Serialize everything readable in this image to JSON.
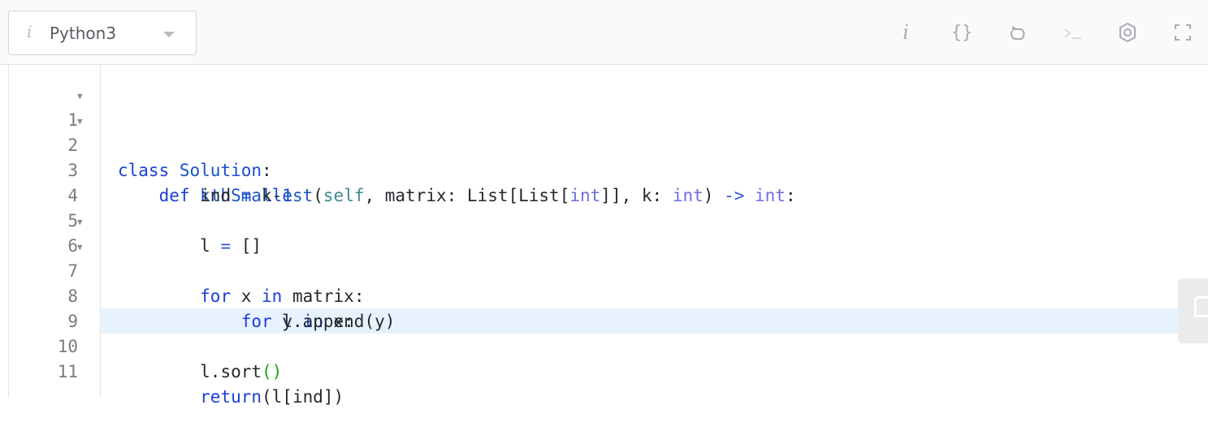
{
  "toolbar": {
    "language": {
      "info_glyph": "i",
      "label": "Python3",
      "caret": "dropdown-caret"
    },
    "icons": {
      "info": "i",
      "braces": "{}",
      "reset": "reset-icon",
      "console": "console-icon",
      "settings": "settings-icon",
      "fullscreen": "fullscreen-icon"
    }
  },
  "editor": {
    "active_line": 10,
    "lines": [
      {
        "n": "1",
        "fold": true
      },
      {
        "n": "2",
        "fold": true
      },
      {
        "n": "3",
        "fold": false
      },
      {
        "n": "4",
        "fold": false
      },
      {
        "n": "5",
        "fold": false
      },
      {
        "n": "6",
        "fold": true
      },
      {
        "n": "7",
        "fold": true
      },
      {
        "n": "8",
        "fold": false
      },
      {
        "n": "9",
        "fold": false
      },
      {
        "n": "10",
        "fold": false
      },
      {
        "n": "11",
        "fold": false
      }
    ],
    "code": {
      "l1": {
        "kw": "class",
        "name": "Solution",
        "rest": ":"
      },
      "l2": {
        "kw": "def",
        "fname": "kthSmallest",
        "p1": "(",
        "self": "self",
        "p2": ", matrix: List[List[",
        "t1": "int",
        "p3": "]], k: ",
        "t2": "int",
        "p4": ") ",
        "arrow": "->",
        "sp": " ",
        "t3": "int",
        "p5": ":"
      },
      "l3": {
        "a": "ind",
        "op": " = ",
        "b": "k-",
        "n": "1"
      },
      "l5": {
        "a": "l",
        "op": " = ",
        "b": "[]"
      },
      "l6": {
        "kw1": "for",
        "a": " x ",
        "kw2": "in",
        "b": " matrix:"
      },
      "l7": {
        "kw1": "for",
        "a": " y ",
        "kw2": "in",
        "b": " x:"
      },
      "l8": {
        "a": "l.append(y)"
      },
      "l10": {
        "a": "l.sort",
        "p": "()"
      },
      "l11": {
        "kw": "return",
        "a": "(l[ind])"
      }
    }
  },
  "colors": {
    "keyword": "#1a3edb",
    "type": "#6a6ee0",
    "self": "#3d8a93",
    "active_line": "#e8f2fd",
    "matched_paren": "#15a31a"
  }
}
